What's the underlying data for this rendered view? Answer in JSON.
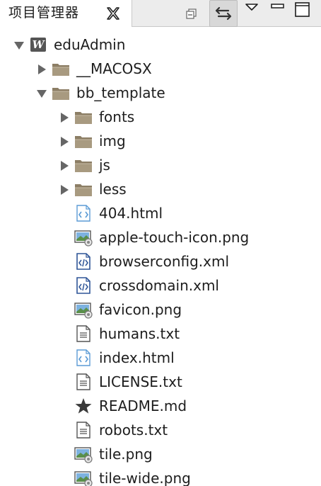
{
  "view": {
    "title": "项目管理器",
    "icons": {
      "close": "close-x-icon",
      "collapse_all": "collapse-all-icon",
      "link_with_editor": "link-with-editor-icon",
      "view_menu": "view-menu-icon",
      "minimize": "minimize-icon",
      "maximize": "maximize-icon"
    },
    "colors": {
      "folder": "#a89a80",
      "html_icon": "#5b9bd5",
      "xml_icon": "#2f5597",
      "project_icon": "#555555"
    }
  },
  "tree": [
    {
      "label": "eduAdmin",
      "type": "project",
      "expanded": true,
      "depth": 0
    },
    {
      "label": "__MACOSX",
      "type": "folder",
      "expanded": false,
      "depth": 1
    },
    {
      "label": "bb_template",
      "type": "folder",
      "expanded": true,
      "depth": 1
    },
    {
      "label": "fonts",
      "type": "folder",
      "expanded": false,
      "depth": 2
    },
    {
      "label": "img",
      "type": "folder",
      "expanded": false,
      "depth": 2
    },
    {
      "label": "js",
      "type": "folder",
      "expanded": false,
      "depth": 2
    },
    {
      "label": "less",
      "type": "folder",
      "expanded": false,
      "depth": 2
    },
    {
      "label": "404.html",
      "type": "html",
      "depth": 2
    },
    {
      "label": "apple-touch-icon.png",
      "type": "image",
      "depth": 2
    },
    {
      "label": "browserconfig.xml",
      "type": "xml",
      "depth": 2
    },
    {
      "label": "crossdomain.xml",
      "type": "xml",
      "depth": 2
    },
    {
      "label": "favicon.png",
      "type": "image",
      "depth": 2
    },
    {
      "label": "humans.txt",
      "type": "text",
      "depth": 2
    },
    {
      "label": "index.html",
      "type": "html",
      "depth": 2
    },
    {
      "label": "LICENSE.txt",
      "type": "text",
      "depth": 2
    },
    {
      "label": "README.md",
      "type": "markdown",
      "depth": 2
    },
    {
      "label": "robots.txt",
      "type": "text",
      "depth": 2
    },
    {
      "label": "tile.png",
      "type": "image",
      "depth": 2
    },
    {
      "label": "tile-wide.png",
      "type": "image",
      "depth": 2
    }
  ]
}
